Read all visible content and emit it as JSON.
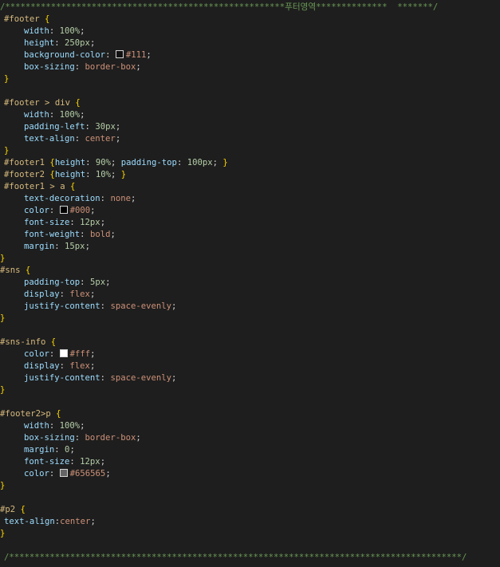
{
  "editor": {
    "language": "css",
    "background": "#1e1e1e",
    "colors": {
      "comment": "#6a9955",
      "selector": "#d7ba7d",
      "brace": "#ffd700",
      "property": "#9cdcfe",
      "number": "#b5cea8",
      "value": "#ce9178",
      "punctuation": "#d4d4d4"
    }
  },
  "lines": [
    {
      "indent": 0,
      "tokens": [
        [
          "comment",
          "/*******************************************************푸터영역**************  *******/"
        ]
      ]
    },
    {
      "indent": 1,
      "tokens": [
        [
          "selector",
          "#footer"
        ],
        [
          "punc",
          " "
        ],
        [
          "brace",
          "{"
        ]
      ]
    },
    {
      "indent": 2,
      "tokens": [
        [
          "prop",
          "width"
        ],
        [
          "punc",
          ": "
        ],
        [
          "num",
          "100%"
        ],
        [
          "punc",
          ";"
        ]
      ]
    },
    {
      "indent": 2,
      "tokens": [
        [
          "prop",
          "height"
        ],
        [
          "punc",
          ": "
        ],
        [
          "num",
          "250px"
        ],
        [
          "punc",
          ";"
        ]
      ]
    },
    {
      "indent": 2,
      "tokens": [
        [
          "prop",
          "background-color"
        ],
        [
          "punc",
          ": "
        ],
        [
          "swatch",
          "#111111"
        ],
        [
          "value",
          "#111"
        ],
        [
          "punc",
          ";"
        ]
      ]
    },
    {
      "indent": 2,
      "tokens": [
        [
          "prop",
          "box-sizing"
        ],
        [
          "punc",
          ": "
        ],
        [
          "value",
          "border-box"
        ],
        [
          "punc",
          ";"
        ]
      ]
    },
    {
      "indent": 1,
      "tokens": [
        [
          "brace",
          "}"
        ]
      ]
    },
    {
      "indent": 0,
      "tokens": []
    },
    {
      "indent": 1,
      "tokens": [
        [
          "selector",
          "#footer"
        ],
        [
          "punc",
          " "
        ],
        [
          "selector",
          ">"
        ],
        [
          "punc",
          " "
        ],
        [
          "selector",
          "div"
        ],
        [
          "punc",
          " "
        ],
        [
          "brace",
          "{"
        ]
      ]
    },
    {
      "indent": 2,
      "tokens": [
        [
          "prop",
          "width"
        ],
        [
          "punc",
          ": "
        ],
        [
          "num",
          "100%"
        ],
        [
          "punc",
          ";"
        ]
      ]
    },
    {
      "indent": 2,
      "tokens": [
        [
          "prop",
          "padding-left"
        ],
        [
          "punc",
          ": "
        ],
        [
          "num",
          "30px"
        ],
        [
          "punc",
          ";"
        ]
      ]
    },
    {
      "indent": 2,
      "tokens": [
        [
          "prop",
          "text-align"
        ],
        [
          "punc",
          ": "
        ],
        [
          "value",
          "center"
        ],
        [
          "punc",
          ";"
        ]
      ]
    },
    {
      "indent": 1,
      "tokens": [
        [
          "brace",
          "}"
        ]
      ]
    },
    {
      "indent": 1,
      "tokens": [
        [
          "selector",
          "#footer1"
        ],
        [
          "punc",
          " "
        ],
        [
          "brace",
          "{"
        ],
        [
          "prop",
          "height"
        ],
        [
          "punc",
          ": "
        ],
        [
          "num",
          "90%"
        ],
        [
          "punc",
          "; "
        ],
        [
          "prop",
          "padding-top"
        ],
        [
          "punc",
          ": "
        ],
        [
          "num",
          "100px"
        ],
        [
          "punc",
          "; "
        ],
        [
          "brace",
          "}"
        ]
      ]
    },
    {
      "indent": 1,
      "tokens": [
        [
          "selector",
          "#footer2"
        ],
        [
          "punc",
          " "
        ],
        [
          "brace",
          "{"
        ],
        [
          "prop",
          "height"
        ],
        [
          "punc",
          ": "
        ],
        [
          "num",
          "10%"
        ],
        [
          "punc",
          "; "
        ],
        [
          "brace",
          "}"
        ]
      ]
    },
    {
      "indent": 1,
      "tokens": [
        [
          "selector",
          "#footer1"
        ],
        [
          "punc",
          " "
        ],
        [
          "selector",
          ">"
        ],
        [
          "punc",
          " "
        ],
        [
          "selector",
          "a"
        ],
        [
          "punc",
          " "
        ],
        [
          "brace",
          "{"
        ]
      ]
    },
    {
      "indent": 2,
      "tokens": [
        [
          "prop",
          "text-decoration"
        ],
        [
          "punc",
          ": "
        ],
        [
          "value",
          "none"
        ],
        [
          "punc",
          ";"
        ]
      ]
    },
    {
      "indent": 2,
      "tokens": [
        [
          "prop",
          "color"
        ],
        [
          "punc",
          ": "
        ],
        [
          "swatch",
          "#000000"
        ],
        [
          "value",
          "#000"
        ],
        [
          "punc",
          ";"
        ]
      ]
    },
    {
      "indent": 2,
      "tokens": [
        [
          "prop",
          "font-size"
        ],
        [
          "punc",
          ": "
        ],
        [
          "num",
          "12px"
        ],
        [
          "punc",
          ";"
        ]
      ]
    },
    {
      "indent": 2,
      "tokens": [
        [
          "prop",
          "font-weight"
        ],
        [
          "punc",
          ": "
        ],
        [
          "value",
          "bold"
        ],
        [
          "punc",
          ";"
        ]
      ]
    },
    {
      "indent": 2,
      "tokens": [
        [
          "prop",
          "margin"
        ],
        [
          "punc",
          ": "
        ],
        [
          "num",
          "15px"
        ],
        [
          "punc",
          ";"
        ]
      ]
    },
    {
      "indent": 0,
      "tokens": [
        [
          "brace",
          "}"
        ]
      ]
    },
    {
      "indent": 0,
      "tokens": [
        [
          "selector",
          "#sns"
        ],
        [
          "punc",
          " "
        ],
        [
          "brace",
          "{"
        ]
      ]
    },
    {
      "indent": 2,
      "tokens": [
        [
          "prop",
          "padding-top"
        ],
        [
          "punc",
          ": "
        ],
        [
          "num",
          "5px"
        ],
        [
          "punc",
          ";"
        ]
      ]
    },
    {
      "indent": 2,
      "tokens": [
        [
          "prop",
          "display"
        ],
        [
          "punc",
          ": "
        ],
        [
          "value",
          "flex"
        ],
        [
          "punc",
          ";"
        ]
      ]
    },
    {
      "indent": 2,
      "tokens": [
        [
          "prop",
          "justify-content"
        ],
        [
          "punc",
          ": "
        ],
        [
          "value",
          "space-evenly"
        ],
        [
          "punc",
          ";"
        ]
      ]
    },
    {
      "indent": 0,
      "tokens": [
        [
          "brace",
          "}"
        ]
      ]
    },
    {
      "indent": 0,
      "tokens": []
    },
    {
      "indent": 0,
      "tokens": [
        [
          "selector",
          "#sns-info"
        ],
        [
          "punc",
          " "
        ],
        [
          "brace",
          "{"
        ]
      ]
    },
    {
      "indent": 2,
      "tokens": [
        [
          "prop",
          "color"
        ],
        [
          "punc",
          ": "
        ],
        [
          "swatch",
          "#ffffff"
        ],
        [
          "value",
          "#fff"
        ],
        [
          "punc",
          ";"
        ]
      ]
    },
    {
      "indent": 2,
      "tokens": [
        [
          "prop",
          "display"
        ],
        [
          "punc",
          ": "
        ],
        [
          "value",
          "flex"
        ],
        [
          "punc",
          ";"
        ]
      ]
    },
    {
      "indent": 2,
      "tokens": [
        [
          "prop",
          "justify-content"
        ],
        [
          "punc",
          ": "
        ],
        [
          "value",
          "space-evenly"
        ],
        [
          "punc",
          ";"
        ]
      ]
    },
    {
      "indent": 0,
      "tokens": [
        [
          "brace",
          "}"
        ]
      ]
    },
    {
      "indent": 0,
      "tokens": []
    },
    {
      "indent": 0,
      "tokens": [
        [
          "selector",
          "#footer2>p"
        ],
        [
          "punc",
          " "
        ],
        [
          "brace",
          "{"
        ]
      ]
    },
    {
      "indent": 2,
      "tokens": [
        [
          "prop",
          "width"
        ],
        [
          "punc",
          ": "
        ],
        [
          "num",
          "100%"
        ],
        [
          "punc",
          ";"
        ]
      ]
    },
    {
      "indent": 2,
      "tokens": [
        [
          "prop",
          "box-sizing"
        ],
        [
          "punc",
          ": "
        ],
        [
          "value",
          "border-box"
        ],
        [
          "punc",
          ";"
        ]
      ]
    },
    {
      "indent": 2,
      "tokens": [
        [
          "prop",
          "margin"
        ],
        [
          "punc",
          ": "
        ],
        [
          "num",
          "0"
        ],
        [
          "punc",
          ";"
        ]
      ]
    },
    {
      "indent": 2,
      "tokens": [
        [
          "prop",
          "font-size"
        ],
        [
          "punc",
          ": "
        ],
        [
          "num",
          "12px"
        ],
        [
          "punc",
          ";"
        ]
      ]
    },
    {
      "indent": 2,
      "tokens": [
        [
          "prop",
          "color"
        ],
        [
          "punc",
          ": "
        ],
        [
          "swatch",
          "#656565"
        ],
        [
          "value",
          "#656565"
        ],
        [
          "punc",
          ";"
        ]
      ]
    },
    {
      "indent": 0,
      "tokens": [
        [
          "brace",
          "}"
        ]
      ]
    },
    {
      "indent": 0,
      "tokens": []
    },
    {
      "indent": 0,
      "tokens": [
        [
          "selector",
          "#p2"
        ],
        [
          "punc",
          " "
        ],
        [
          "brace",
          "{"
        ]
      ]
    },
    {
      "indent": 1,
      "tokens": [
        [
          "prop",
          "text-align"
        ],
        [
          "punc",
          ":"
        ],
        [
          "value",
          "center"
        ],
        [
          "punc",
          ";"
        ]
      ]
    },
    {
      "indent": 0,
      "tokens": [
        [
          "brace",
          "}"
        ]
      ]
    },
    {
      "indent": 0,
      "tokens": []
    },
    {
      "indent": 1,
      "tokens": [
        [
          "comment",
          "/*****************************************************************************************/"
        ]
      ]
    }
  ]
}
